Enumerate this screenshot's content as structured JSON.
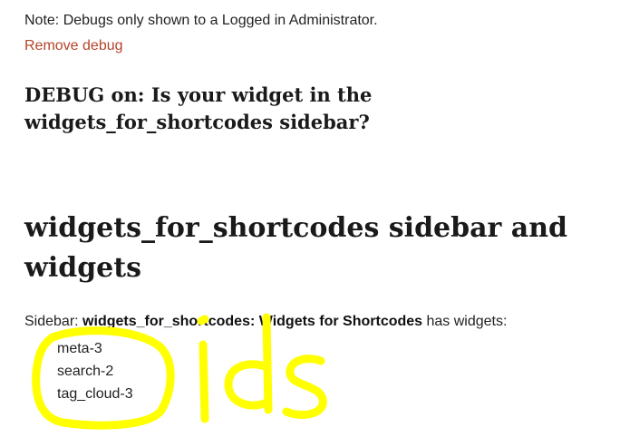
{
  "note": {
    "text": "Note: Debugs only shown to a Logged in Administrator."
  },
  "remove_debug": {
    "label": "Remove debug",
    "color": "#b5432a"
  },
  "debug_heading": {
    "line1": "DEBUG on: Is your widget in the",
    "line2": "widgets_for_shortcodes sidebar?"
  },
  "main_heading": {
    "line1": "widgets_for_shortcodes sidebar and",
    "line2": "widgets"
  },
  "sidebar_info": {
    "prefix": "Sidebar: ",
    "name": "widgets_for_shortcodes: Widgets for Shortcodes",
    "suffix": " has widgets:"
  },
  "widgets": [
    "meta-3",
    "search-2",
    "tag_cloud-3"
  ],
  "annotation": {
    "handwritten_text": "ids",
    "color": "#ffff00"
  }
}
